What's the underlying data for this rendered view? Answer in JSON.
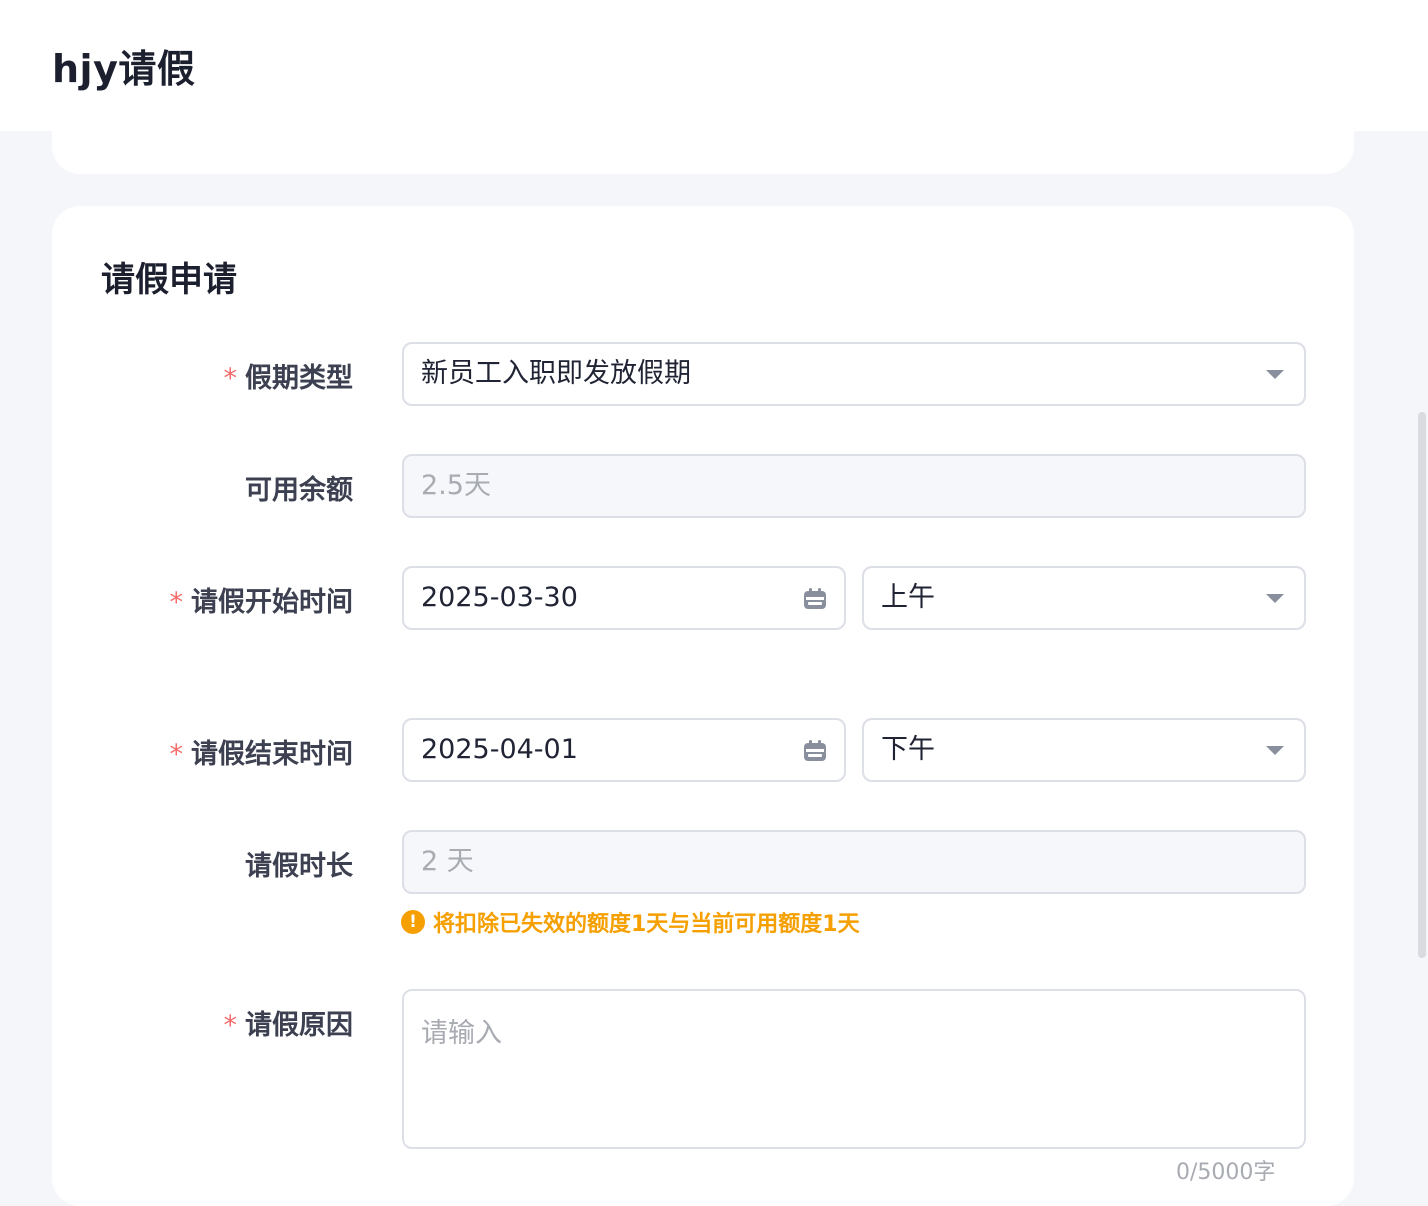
{
  "header": {
    "title": "hjy请假"
  },
  "form": {
    "title": "请假申请",
    "required_mark": "*",
    "leave_type": {
      "label": "假期类型",
      "value": "新员工入职即发放假期"
    },
    "balance": {
      "label": "可用余额",
      "value": "2.5天"
    },
    "start": {
      "label": "请假开始时间",
      "date": "2025-03-30",
      "period": "上午"
    },
    "end": {
      "label": "请假结束时间",
      "date": "2025-04-01",
      "period": "下午"
    },
    "duration": {
      "label": "请假时长",
      "value": "2 天"
    },
    "hint": {
      "icon": "!",
      "text": "将扣除已失效的额度1天与当前可用额度1天",
      "color": "#f5a000"
    },
    "reason": {
      "label": "请假原因",
      "placeholder": "请输入",
      "counter": "0/5000字"
    }
  }
}
